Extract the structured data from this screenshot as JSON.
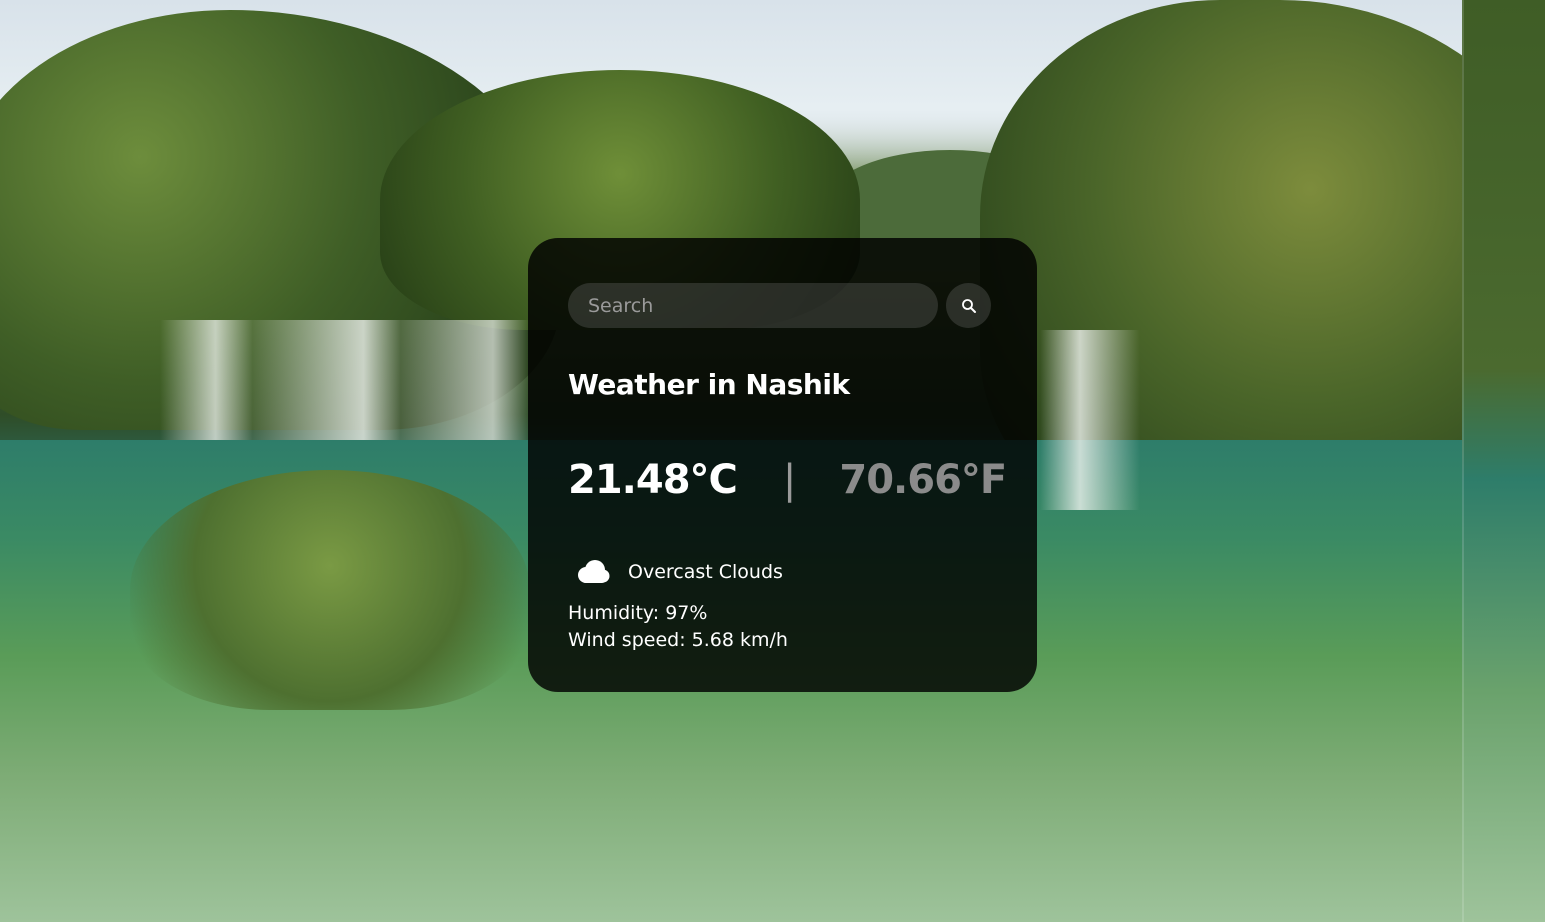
{
  "search": {
    "placeholder": "Search",
    "value": "",
    "button_icon": "search-icon"
  },
  "weather": {
    "title": "Weather in Nashik",
    "temp_c": "21.48°C",
    "separator": "|",
    "temp_f": "70.66°F",
    "condition_icon": "cloud-icon",
    "condition": "Overcast Clouds",
    "humidity": "Humidity: 97%",
    "wind": "Wind speed: 5.68 km/h"
  },
  "colors": {
    "card_bg": "#000000",
    "text_primary": "#ffffff",
    "text_muted": "#8b8b8b",
    "input_bg": "#7c7c7c"
  }
}
